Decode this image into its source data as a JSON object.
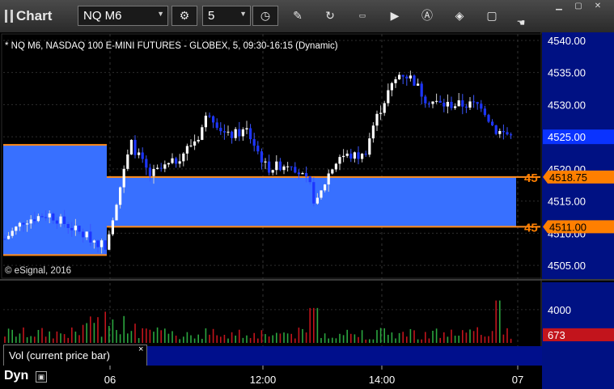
{
  "window": {
    "title": "Chart",
    "symbol": "NQ M6",
    "interval": "5",
    "controls": [
      "minimize-icon",
      "maximize-icon",
      "close-icon"
    ]
  },
  "toolbar": {
    "icons": [
      "period-settings-icon",
      "clock-icon",
      "pencil-icon",
      "refresh-icon",
      "get-icon",
      "play-icon",
      "alert-icon",
      "tag-icon",
      "comment-icon",
      "cursor-icon"
    ]
  },
  "chart_header": "* NQ M6, NASDAQ 100 E-MINI FUTURES - GLOBEX, 5, 09:30-16:15 (Dynamic)",
  "copyright": "© eSignal, 2016",
  "colors": {
    "up_candle": "#ffffff",
    "down_candle": "#1c35ff",
    "zone_fill": "#3870ff",
    "zone_line": "#ff8c1a",
    "axis_bg": "#001183",
    "price_tag_bg": "#0a33ff",
    "level_tag_bg": "#ff7f00",
    "volume_up": "#2ba63f",
    "volume_down": "#c2141c",
    "volume_tag_bg": "#c2141c"
  },
  "chart_data": [
    {
      "type": "candlestick",
      "title": "NQ M6",
      "ylim": [
        4503,
        4541
      ],
      "y_ticks": [
        4505,
        4510,
        4515,
        4520,
        4525,
        4530,
        4535,
        4540
      ],
      "y_tick_labels": [
        "4505.00",
        "4510.00",
        "4515.00",
        "4520.00",
        "4525.00",
        "4530.00",
        "4535.00",
        "4540.00"
      ],
      "x_tick_labels": [
        "06",
        "12:00",
        "14:00",
        "07"
      ],
      "last_price": "4525.00",
      "levels": [
        {
          "label": "45",
          "value_text": "4518.75",
          "value": 4518.75
        },
        {
          "label": "45",
          "value_text": "4511.00",
          "value": 4511.0
        }
      ],
      "zones": [
        {
          "name": "prior-session-zone",
          "top": 4523.75,
          "bottom": 4506.6
        },
        {
          "name": "current-zone",
          "top": 4518.75,
          "bottom": 4511.0
        }
      ],
      "grid": true
    },
    {
      "type": "bar",
      "title": "Vol (current price bar)",
      "y_tick_labels": [
        "4000"
      ],
      "y_ticks": [
        4000
      ],
      "ylim": [
        0,
        7200
      ],
      "last_value": "673"
    }
  ],
  "footer": {
    "volume_pane_label": "Vol (current price bar)",
    "close_glyph": "×",
    "mode_label": "Dyn",
    "mode_icon": "lock-icon"
  }
}
